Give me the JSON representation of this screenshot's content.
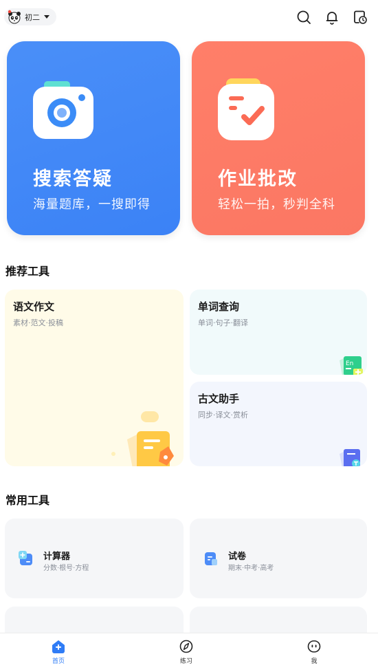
{
  "header": {
    "grade": "初二",
    "colors": {
      "accent": "#2f7cf6"
    }
  },
  "hero": [
    {
      "title": "搜索答疑",
      "subtitle": "海量题库，一搜即得",
      "color": "#4a8ff8"
    },
    {
      "title": "作业批改",
      "subtitle": "轻松一拍，秒判全科",
      "color": "#ff7f69"
    }
  ],
  "recommended": {
    "title": "推荐工具",
    "items": [
      {
        "name": "语文作文",
        "desc": "素材·范文·投稿",
        "bg": "#fffbe8"
      },
      {
        "name": "单词查询",
        "desc": "单词·句子·翻译",
        "bg": "#f1fafb"
      },
      {
        "name": "古文助手",
        "desc": "同步·译文·赏析",
        "bg": "#f3f6fd"
      }
    ]
  },
  "common": {
    "title": "常用工具",
    "items": [
      {
        "name": "计算器",
        "desc": "分数·根号·方程"
      },
      {
        "name": "试卷",
        "desc": "期末·中考·高考"
      }
    ]
  },
  "nav": {
    "items": [
      {
        "label": "首页",
        "icon": "home-icon",
        "active": true
      },
      {
        "label": "练习",
        "icon": "compass-icon",
        "active": false
      },
      {
        "label": "我",
        "icon": "face-icon",
        "active": false
      }
    ]
  }
}
